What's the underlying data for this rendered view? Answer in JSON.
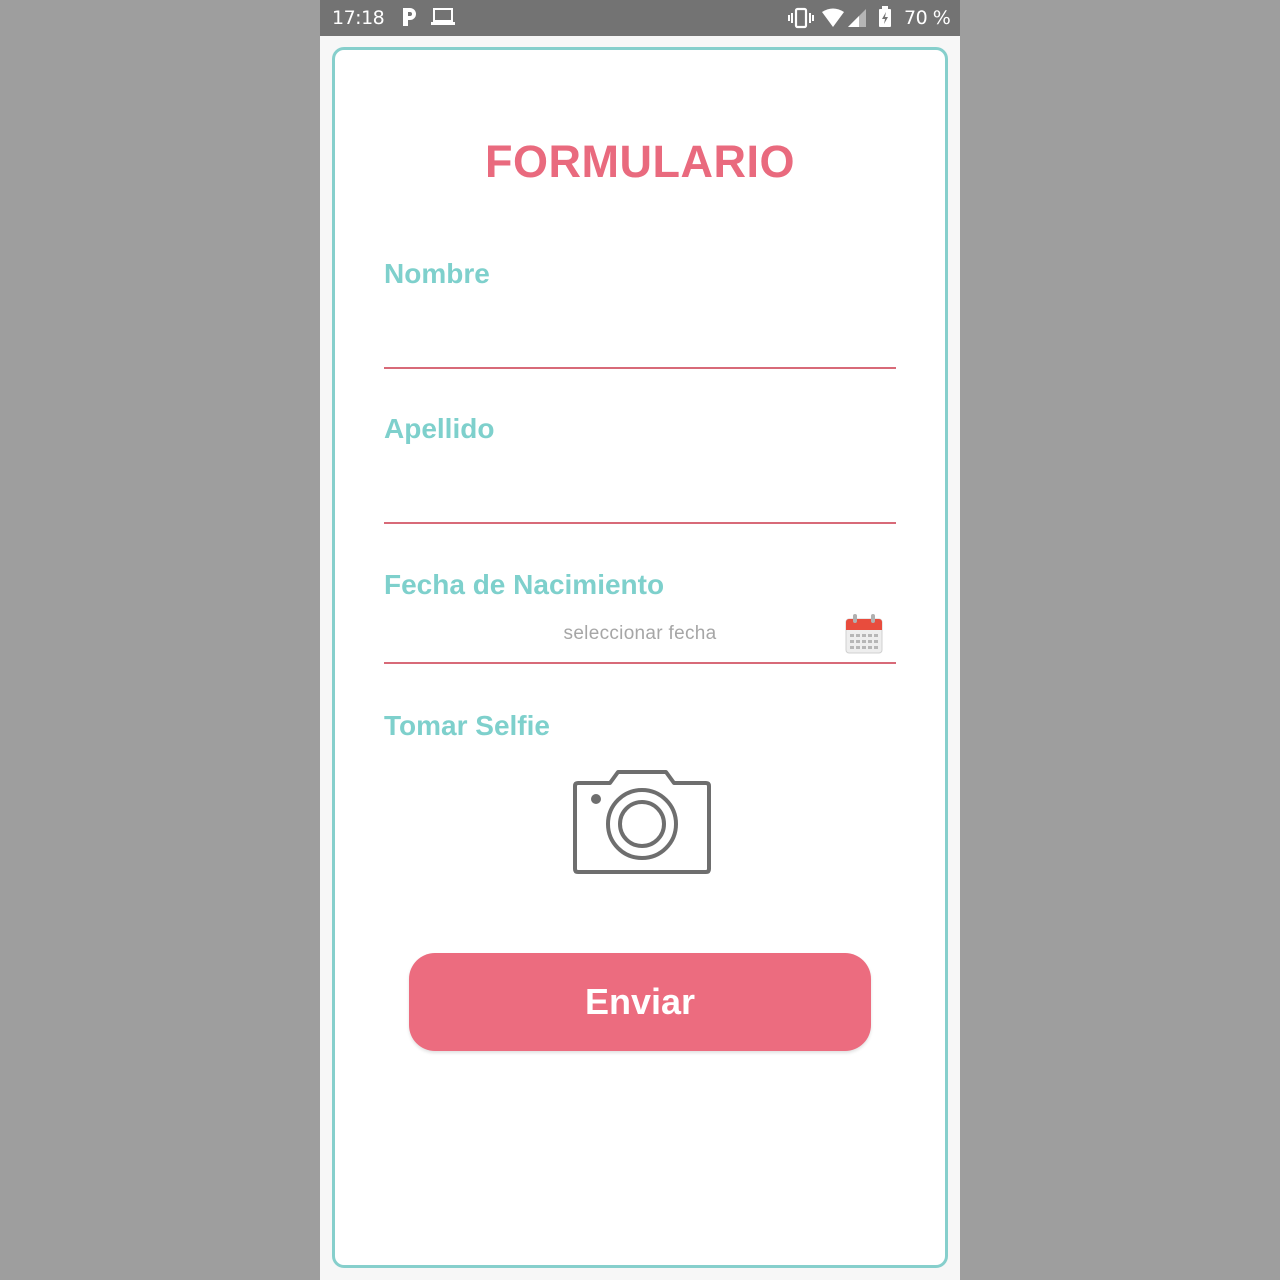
{
  "status_bar": {
    "time": "17:18",
    "battery_percent": "70 %",
    "icons": [
      "parking-icon",
      "laptop-icon",
      "vibrate-icon",
      "wifi-icon",
      "signal-icon",
      "battery-icon"
    ]
  },
  "form": {
    "title": "FORMULARIO",
    "fields": {
      "nombre": {
        "label": "Nombre",
        "value": ""
      },
      "apellido": {
        "label": "Apellido",
        "value": ""
      },
      "fecha": {
        "label": "Fecha de Nacimiento",
        "placeholder": "seleccionar fecha"
      },
      "selfie": {
        "label": "Tomar Selfie"
      }
    },
    "submit_label": "Enviar"
  },
  "colors": {
    "accent_teal": "#7ed0cc",
    "accent_pink": "#ec6c7f",
    "title_pink": "#e96a7e",
    "underline": "#d86a78",
    "status_bar": "#737373",
    "outer_background": "#9e9e9e"
  }
}
